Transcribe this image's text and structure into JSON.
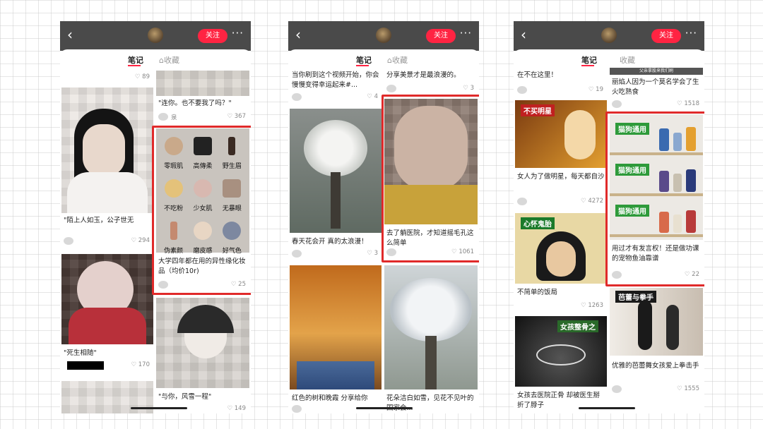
{
  "phone1": {
    "follow": "关注",
    "more": "···",
    "tab_notes": "笔记",
    "tab_collect": "收藏",
    "top_likes": "89",
    "note_a": {
      "title": "\"连你。也不要我了吗？\"",
      "user": "泉",
      "likes": "367"
    },
    "note_b": {
      "title": "\"陌上人如玉，公子世无",
      "likes": "294"
    },
    "note_c": {
      "title": "大学四年都在用的异性缘化妆品（均价10r)",
      "likes": "25",
      "grid": [
        {
          "label": "零瑕肌",
          "color": "#c9a98a"
        },
        {
          "label": "高傳柔",
          "color": "#222"
        },
        {
          "label": "野生眉",
          "color": "#3a2a22"
        },
        {
          "label": "不吃粉",
          "color": "#e4c27a"
        },
        {
          "label": "少女肌",
          "color": "#d8b8b0"
        },
        {
          "label": "无暴眼",
          "color": "#a89080"
        },
        {
          "label": "伪素颜",
          "color": "#c48a70"
        },
        {
          "label": "磨皮感",
          "color": "#e8d6c4"
        },
        {
          "label": "好气色",
          "color": "#7d88a0"
        }
      ]
    },
    "note_d": {
      "title": "\"死生相随\"",
      "likes": "170"
    },
    "note_e": {
      "title": "\"与你，风雪一程\"",
      "likes": "149"
    }
  },
  "phone2": {
    "follow": "关注",
    "more": "···",
    "tab_notes": "笔记",
    "tab_collect": "收藏",
    "note_a": {
      "title": "当你刷到这个视频开始，你会慢慢变得幸运起来#...",
      "likes": "4"
    },
    "note_b": {
      "title": "分享美景才是最浪漫的。",
      "likes": "3"
    },
    "note_c": {
      "title": "春天花会开 真的太浪漫！",
      "likes": "3"
    },
    "note_d": {
      "title": "去了躺医院，才知道摇毛孔这么简单",
      "likes": "1061"
    },
    "note_e": {
      "title": "红色的树和晚霞 分享给你"
    },
    "note_f": {
      "title": "花朵洁白如雪，见花不见叶的国家会..."
    }
  },
  "phone3": {
    "follow": "关注",
    "more": "···",
    "tab_notes": "笔记",
    "tab_collect": "收藏",
    "top_banner": "父亲拿股来我们刷",
    "note_a": {
      "title": "在不在这里！",
      "likes": "19"
    },
    "note_b": {
      "title": "丽焰人因为一个莫名学会了生火吃熟食",
      "likes": "1518"
    },
    "note_c": {
      "title": "女人为了做明星，每天都自沙",
      "likes": "4272",
      "tag": "不买明星"
    },
    "note_d": {
      "title": "用过才有发言权！还是做功课的宠物鱼油靠谱",
      "likes": "22",
      "tags": [
        "猫狗通用",
        "猫狗通用",
        "猫狗通用"
      ]
    },
    "note_e": {
      "title": "不简单的饭局",
      "likes": "1263",
      "tag": "心怀鬼胎"
    },
    "note_f": {
      "title": "优雅的芭蕾舞女孩爱上拳击手",
      "likes": "1555",
      "tag": "芭蕾与拳手"
    },
    "note_g": {
      "title": "女孩去医院正骨 却被医生掰折了脖子",
      "tag": "女孩整骨之"
    }
  }
}
